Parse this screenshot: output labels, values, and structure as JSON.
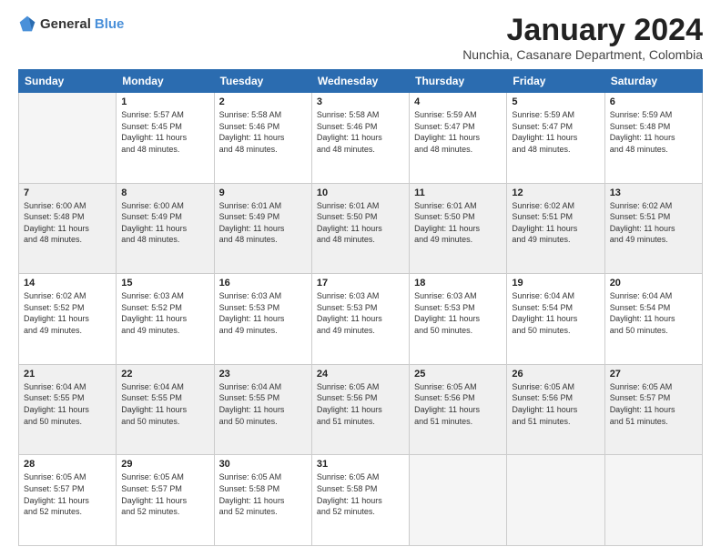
{
  "logo": {
    "general": "General",
    "blue": "Blue"
  },
  "title": "January 2024",
  "subtitle": "Nunchia, Casanare Department, Colombia",
  "weekdays": [
    "Sunday",
    "Monday",
    "Tuesday",
    "Wednesday",
    "Thursday",
    "Friday",
    "Saturday"
  ],
  "weeks": [
    [
      {
        "day": "",
        "info": ""
      },
      {
        "day": "1",
        "info": "Sunrise: 5:57 AM\nSunset: 5:45 PM\nDaylight: 11 hours\nand 48 minutes."
      },
      {
        "day": "2",
        "info": "Sunrise: 5:58 AM\nSunset: 5:46 PM\nDaylight: 11 hours\nand 48 minutes."
      },
      {
        "day": "3",
        "info": "Sunrise: 5:58 AM\nSunset: 5:46 PM\nDaylight: 11 hours\nand 48 minutes."
      },
      {
        "day": "4",
        "info": "Sunrise: 5:59 AM\nSunset: 5:47 PM\nDaylight: 11 hours\nand 48 minutes."
      },
      {
        "day": "5",
        "info": "Sunrise: 5:59 AM\nSunset: 5:47 PM\nDaylight: 11 hours\nand 48 minutes."
      },
      {
        "day": "6",
        "info": "Sunrise: 5:59 AM\nSunset: 5:48 PM\nDaylight: 11 hours\nand 48 minutes."
      }
    ],
    [
      {
        "day": "7",
        "info": "Sunrise: 6:00 AM\nSunset: 5:48 PM\nDaylight: 11 hours\nand 48 minutes."
      },
      {
        "day": "8",
        "info": "Sunrise: 6:00 AM\nSunset: 5:49 PM\nDaylight: 11 hours\nand 48 minutes."
      },
      {
        "day": "9",
        "info": "Sunrise: 6:01 AM\nSunset: 5:49 PM\nDaylight: 11 hours\nand 48 minutes."
      },
      {
        "day": "10",
        "info": "Sunrise: 6:01 AM\nSunset: 5:50 PM\nDaylight: 11 hours\nand 48 minutes."
      },
      {
        "day": "11",
        "info": "Sunrise: 6:01 AM\nSunset: 5:50 PM\nDaylight: 11 hours\nand 49 minutes."
      },
      {
        "day": "12",
        "info": "Sunrise: 6:02 AM\nSunset: 5:51 PM\nDaylight: 11 hours\nand 49 minutes."
      },
      {
        "day": "13",
        "info": "Sunrise: 6:02 AM\nSunset: 5:51 PM\nDaylight: 11 hours\nand 49 minutes."
      }
    ],
    [
      {
        "day": "14",
        "info": "Sunrise: 6:02 AM\nSunset: 5:52 PM\nDaylight: 11 hours\nand 49 minutes."
      },
      {
        "day": "15",
        "info": "Sunrise: 6:03 AM\nSunset: 5:52 PM\nDaylight: 11 hours\nand 49 minutes."
      },
      {
        "day": "16",
        "info": "Sunrise: 6:03 AM\nSunset: 5:53 PM\nDaylight: 11 hours\nand 49 minutes."
      },
      {
        "day": "17",
        "info": "Sunrise: 6:03 AM\nSunset: 5:53 PM\nDaylight: 11 hours\nand 49 minutes."
      },
      {
        "day": "18",
        "info": "Sunrise: 6:03 AM\nSunset: 5:53 PM\nDaylight: 11 hours\nand 50 minutes."
      },
      {
        "day": "19",
        "info": "Sunrise: 6:04 AM\nSunset: 5:54 PM\nDaylight: 11 hours\nand 50 minutes."
      },
      {
        "day": "20",
        "info": "Sunrise: 6:04 AM\nSunset: 5:54 PM\nDaylight: 11 hours\nand 50 minutes."
      }
    ],
    [
      {
        "day": "21",
        "info": "Sunrise: 6:04 AM\nSunset: 5:55 PM\nDaylight: 11 hours\nand 50 minutes."
      },
      {
        "day": "22",
        "info": "Sunrise: 6:04 AM\nSunset: 5:55 PM\nDaylight: 11 hours\nand 50 minutes."
      },
      {
        "day": "23",
        "info": "Sunrise: 6:04 AM\nSunset: 5:55 PM\nDaylight: 11 hours\nand 50 minutes."
      },
      {
        "day": "24",
        "info": "Sunrise: 6:05 AM\nSunset: 5:56 PM\nDaylight: 11 hours\nand 51 minutes."
      },
      {
        "day": "25",
        "info": "Sunrise: 6:05 AM\nSunset: 5:56 PM\nDaylight: 11 hours\nand 51 minutes."
      },
      {
        "day": "26",
        "info": "Sunrise: 6:05 AM\nSunset: 5:56 PM\nDaylight: 11 hours\nand 51 minutes."
      },
      {
        "day": "27",
        "info": "Sunrise: 6:05 AM\nSunset: 5:57 PM\nDaylight: 11 hours\nand 51 minutes."
      }
    ],
    [
      {
        "day": "28",
        "info": "Sunrise: 6:05 AM\nSunset: 5:57 PM\nDaylight: 11 hours\nand 52 minutes."
      },
      {
        "day": "29",
        "info": "Sunrise: 6:05 AM\nSunset: 5:57 PM\nDaylight: 11 hours\nand 52 minutes."
      },
      {
        "day": "30",
        "info": "Sunrise: 6:05 AM\nSunset: 5:58 PM\nDaylight: 11 hours\nand 52 minutes."
      },
      {
        "day": "31",
        "info": "Sunrise: 6:05 AM\nSunset: 5:58 PM\nDaylight: 11 hours\nand 52 minutes."
      },
      {
        "day": "",
        "info": ""
      },
      {
        "day": "",
        "info": ""
      },
      {
        "day": "",
        "info": ""
      }
    ]
  ]
}
